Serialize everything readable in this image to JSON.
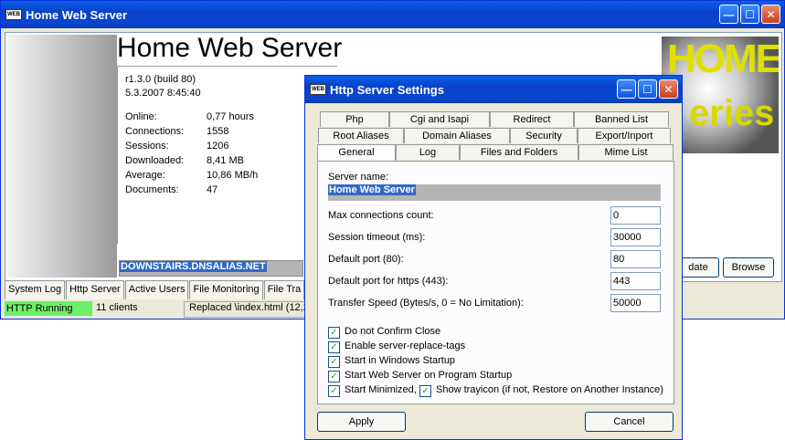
{
  "main": {
    "title": "Home Web Server",
    "app_icon_text": "WEB",
    "heading": "Home Web Server",
    "version": "r1.3.0 (build 80)",
    "datetime": "5.3.2007 8:45:40",
    "stats": [
      {
        "key": "Online:",
        "value": "0,77 hours"
      },
      {
        "key": "Connections:",
        "value": "1558"
      },
      {
        "key": "Sessions:",
        "value": "1206"
      },
      {
        "key": "Downloaded:",
        "value": "8,41 MB"
      },
      {
        "key": "Average:",
        "value": "10,86 MB/h"
      },
      {
        "key": "Documents:",
        "value": "47"
      }
    ],
    "hostname": "DOWNSTAIRS.DNSALIAS.NET",
    "logo": {
      "line1": "HOME",
      "line2": "eries"
    },
    "update_label": "date",
    "browse_label": "Browse",
    "tabs": [
      "System Log",
      "Http Server",
      "Active Users",
      "File Monitoring",
      "File Tra"
    ],
    "status": {
      "running": "HTTP Running",
      "clients": "11 clients",
      "message": "Replaced \\index.html (12,2"
    }
  },
  "dialog": {
    "title": "Http Server Settings",
    "icon_text": "WEB",
    "tabs_row1": [
      "Php",
      "Cgi and Isapi",
      "Redirect",
      "Banned List"
    ],
    "tabs_row2": [
      "Root Aliases",
      "Domain Aliases",
      "Security",
      "Export/Inport"
    ],
    "tabs_row3": [
      "General",
      "Log",
      "Files and Folders",
      "Mime List"
    ],
    "server_name_label": "Server name:",
    "server_name_value": "Home Web Server",
    "fields": [
      {
        "label": "Max connections count:",
        "value": "0"
      },
      {
        "label": "Session timeout (ms):",
        "value": "30000"
      },
      {
        "label": "Default port (80):",
        "value": "80"
      },
      {
        "label": "Default port for https (443):",
        "value": "443"
      },
      {
        "label": "Transfer Speed (Bytes/s, 0 = No Limitation):",
        "value": "50000"
      }
    ],
    "checks": [
      {
        "label": "Do not Confirm Close",
        "checked": true
      },
      {
        "label": "Enable server-replace-tags",
        "checked": true
      },
      {
        "label": "Start in Windows Startup",
        "checked": true
      },
      {
        "label": "Start Web Server on Program Startup",
        "checked": true
      },
      {
        "label": "Start Minimized,",
        "checked": true
      },
      {
        "label": "Show trayicon (if not, Restore on Another Instance)",
        "checked": true
      }
    ],
    "apply_label": "Apply",
    "cancel_label": "Cancel"
  },
  "colors": {
    "titlebar": "#0a46cf",
    "status_green": "#6df068",
    "selection": "#316ac5"
  }
}
